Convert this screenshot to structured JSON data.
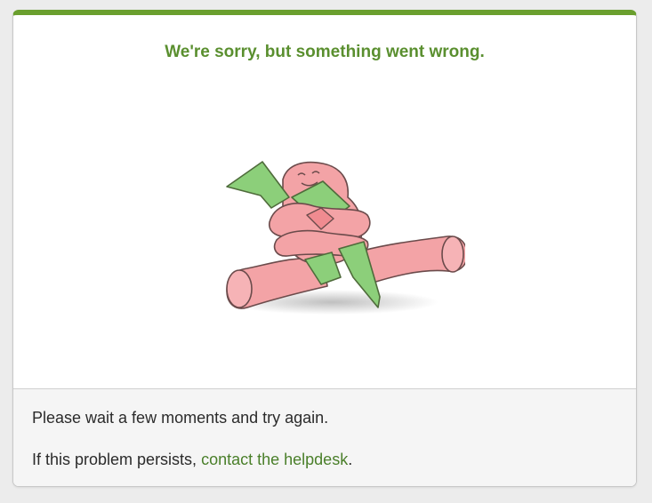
{
  "error": {
    "title": "We're sorry, but something went wrong.",
    "illustration_icon": "pink-creature-hugging-green-ribbon-icon",
    "message_wait": "Please wait a few moments and try again.",
    "message_persist_prefix": "If this problem persists, ",
    "helpdesk_link": "contact the helpdesk",
    "message_persist_suffix": "."
  },
  "colors": {
    "accent": "#6a9f2e",
    "title": "#5a8f2f",
    "link": "#4a7f2a",
    "footer_bg": "#f5f5f5",
    "page_bg": "#ececec"
  }
}
